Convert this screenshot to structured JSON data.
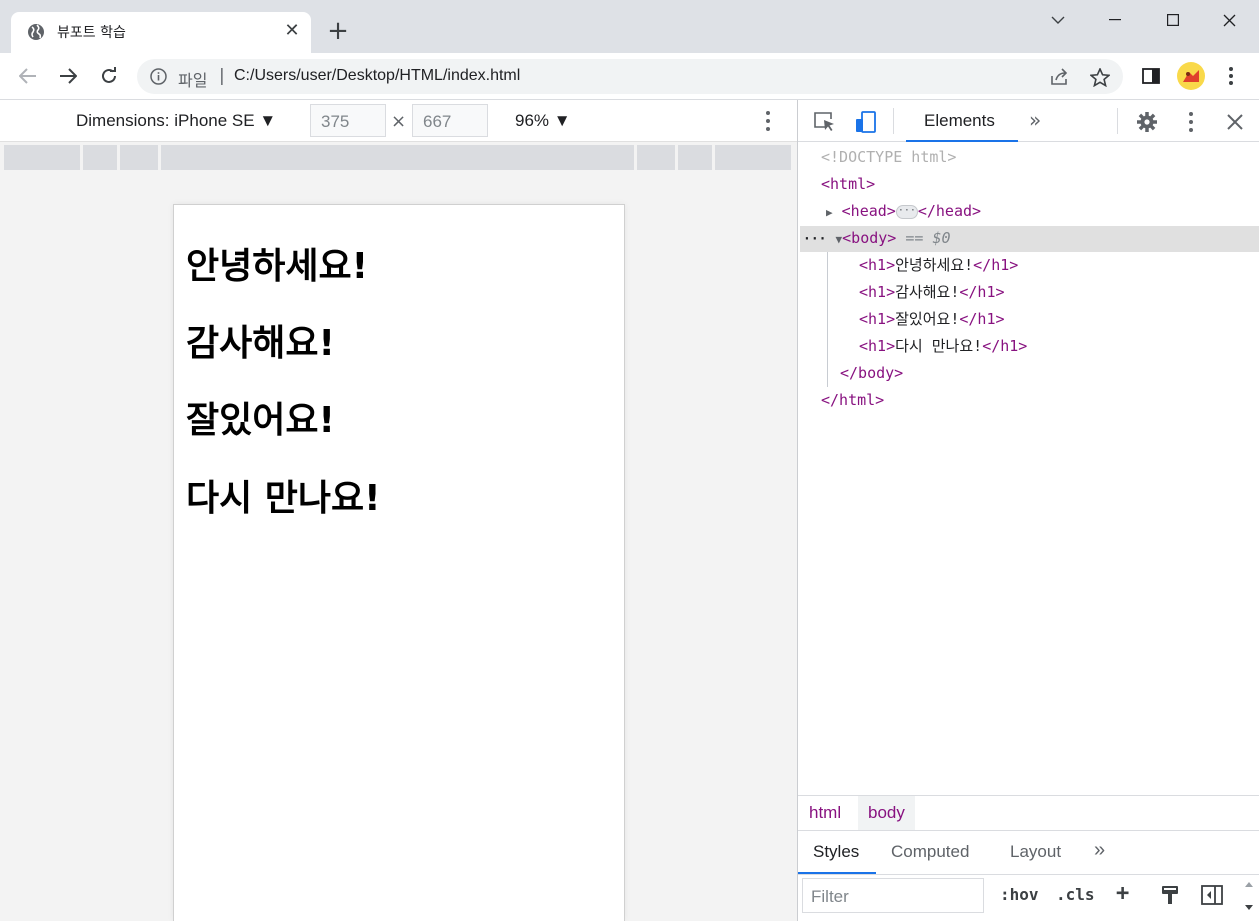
{
  "browser": {
    "tab_title": "뷰포트 학습",
    "url_scheme_label": "파일",
    "url_separator": "|",
    "url": "C:/Users/user/Desktop/HTML/index.html"
  },
  "device_toolbar": {
    "dimensions_label": "Dimensions: iPhone SE ▼",
    "width_value": "375",
    "times_sign": "×",
    "height_value": "667",
    "zoom_label": "96% ▼"
  },
  "page": {
    "headings": [
      "안녕하세요!",
      "감사해요!",
      "잘있어요!",
      "다시 만나요!"
    ]
  },
  "devtools": {
    "tab_elements": "Elements",
    "more_tabs": "»",
    "dom": {
      "doctype": "<!DOCTYPE html>",
      "html_open": "<html>",
      "head_open": "<head>",
      "head_badge": "···",
      "head_close": "</head>",
      "body_open": "<body>",
      "body_marker": "== $0",
      "h1_open": "<h1>",
      "h1_close": "</h1>",
      "body_close": "</body>",
      "html_close": "</html>",
      "row_ellipsis": "···"
    },
    "breadcrumb": [
      "html",
      "body"
    ],
    "style_tabs": [
      "Styles",
      "Computed",
      "Layout",
      "»"
    ],
    "filter_placeholder": "Filter",
    "hov_label": ":hov",
    "cls_label": ".cls",
    "plus_label": "+"
  }
}
